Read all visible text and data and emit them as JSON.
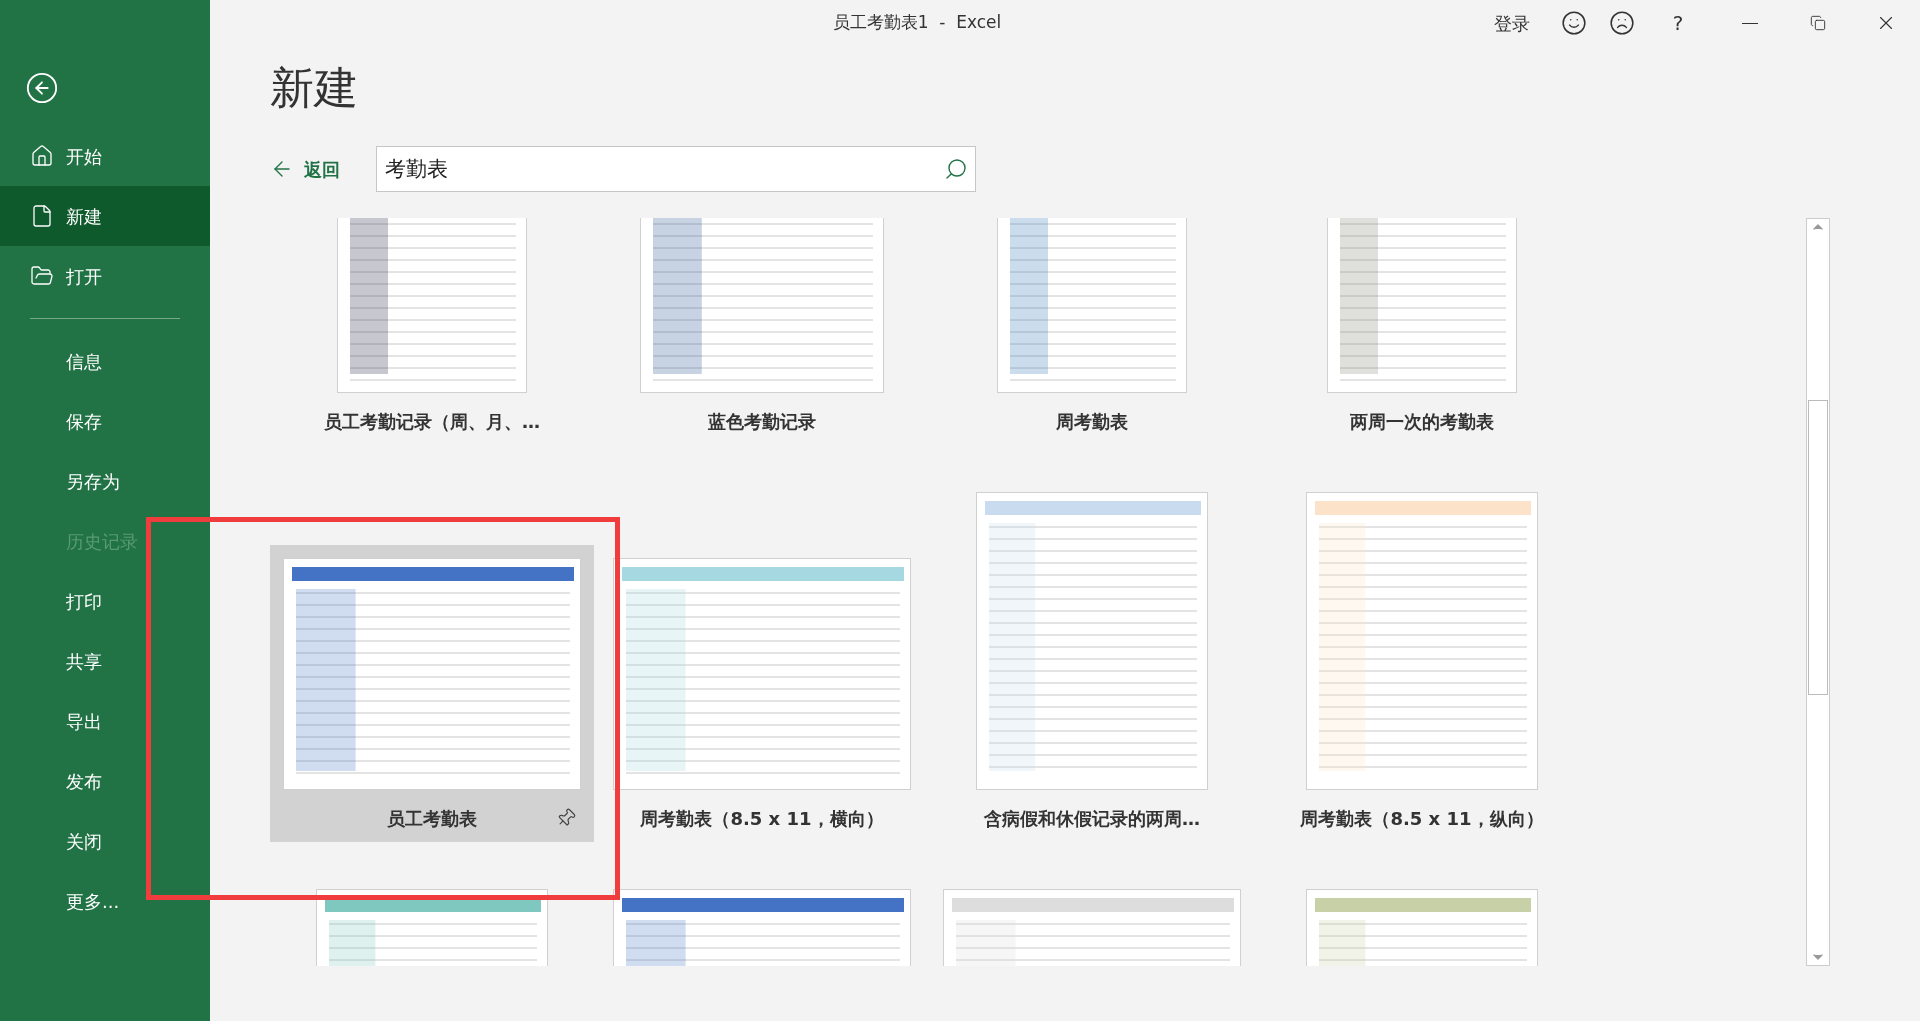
{
  "window": {
    "title": "员工考勤表1  -  Excel",
    "sign_in": "登录",
    "help": "?"
  },
  "sidebar": {
    "primary": [
      {
        "label": "开始",
        "kind": "home",
        "selected": false
      },
      {
        "label": "新建",
        "kind": "new",
        "selected": true
      },
      {
        "label": "打开",
        "kind": "open",
        "selected": false
      }
    ],
    "secondary": [
      {
        "label": "信息",
        "disabled": false
      },
      {
        "label": "保存",
        "disabled": false
      },
      {
        "label": "另存为",
        "disabled": false
      },
      {
        "label": "历史记录",
        "disabled": true
      },
      {
        "label": "打印",
        "disabled": false
      },
      {
        "label": "共享",
        "disabled": false
      },
      {
        "label": "导出",
        "disabled": false
      },
      {
        "label": "发布",
        "disabled": false
      },
      {
        "label": "关闭",
        "disabled": false
      },
      {
        "label": "更多...",
        "disabled": false
      }
    ]
  },
  "page": {
    "heading": "新建",
    "back_link": "返回",
    "search": {
      "value": "考勤表"
    }
  },
  "templates": [
    {
      "title": "员工考勤记录（周、月、…",
      "selected": false
    },
    {
      "title": "蓝色考勤记录",
      "selected": false
    },
    {
      "title": "周考勤表",
      "selected": false
    },
    {
      "title": "两周一次的考勤表",
      "selected": false
    },
    {
      "title": "员工考勤表",
      "selected": true
    },
    {
      "title": "周考勤表（8.5 x 11，横向）",
      "selected": false
    },
    {
      "title": "含病假和休假记录的两周…",
      "selected": false
    },
    {
      "title": "周考勤表（8.5 x 11，纵向）",
      "selected": false
    },
    {
      "selected": false
    },
    {
      "selected": false
    },
    {
      "selected": false
    },
    {
      "selected": false
    }
  ]
}
